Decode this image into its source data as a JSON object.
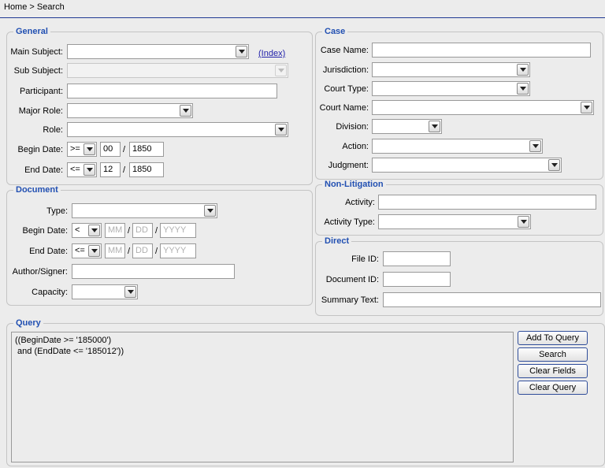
{
  "breadcrumb": "Home > Search",
  "general": {
    "legend": "General",
    "main_subject_label": "Main Subject:",
    "main_subject_value": "",
    "index_link": "(Index)",
    "sub_subject_label": "Sub Subject:",
    "sub_subject_value": "",
    "participant_label": "Participant:",
    "participant_value": "",
    "major_role_label": "Major Role:",
    "major_role_value": "",
    "role_label": "Role:",
    "role_value": "",
    "begin_date_label": "Begin Date:",
    "begin_op": ">=",
    "begin_month": "00",
    "begin_year": "1850",
    "end_date_label": "End Date:",
    "end_op": "<=",
    "end_month": "12",
    "end_year": "1850",
    "slash": "/"
  },
  "document": {
    "legend": "Document",
    "type_label": "Type:",
    "type_value": "",
    "begin_date_label": "Begin Date:",
    "begin_op": "<",
    "begin_month_placeholder": "MM",
    "begin_day_placeholder": "DD",
    "begin_year_placeholder": "YYYY",
    "end_date_label": "End Date:",
    "end_op": "<=",
    "end_month_placeholder": "MM",
    "end_day_placeholder": "DD",
    "end_year_placeholder": "YYYY",
    "author_label": "Author/Signer:",
    "author_value": "",
    "capacity_label": "Capacity:",
    "capacity_value": ""
  },
  "case": {
    "legend": "Case",
    "case_name_label": "Case Name:",
    "case_name_value": "",
    "jurisdiction_label": "Jurisdiction:",
    "jurisdiction_value": "",
    "court_type_label": "Court Type:",
    "court_type_value": "",
    "court_name_label": "Court Name:",
    "court_name_value": "",
    "division_label": "Division:",
    "division_value": "",
    "action_label": "Action:",
    "action_value": "",
    "judgment_label": "Judgment:",
    "judgment_value": ""
  },
  "non_litigation": {
    "legend": "Non-Litigation",
    "activity_label": "Activity:",
    "activity_value": "",
    "activity_type_label": "Activity Type:",
    "activity_type_value": ""
  },
  "direct": {
    "legend": "Direct",
    "file_id_label": "File ID:",
    "file_id_value": "",
    "document_id_label": "Document ID:",
    "document_id_value": "",
    "summary_text_label": "Summary Text:",
    "summary_text_value": ""
  },
  "query": {
    "legend": "Query",
    "lines": [
      "((BeginDate >= '185000')",
      " and (EndDate <= '185012'))"
    ],
    "buttons": {
      "add": "Add To Query",
      "search": "Search",
      "clear_fields": "Clear Fields",
      "clear_query": "Clear Query"
    }
  },
  "icons": {
    "dropdown": "chevron-down-icon"
  }
}
